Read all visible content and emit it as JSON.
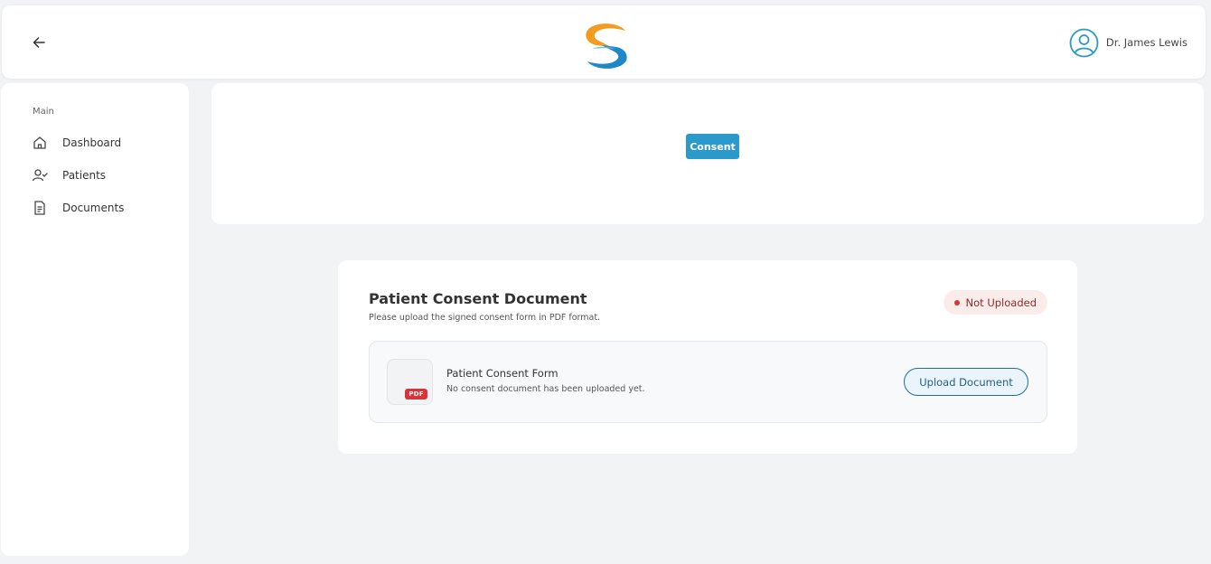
{
  "colors": {
    "accent": "#2b9acb",
    "status_not_uploaded": "#d8343c",
    "badge_bg": "#fbecec",
    "logo_orange": "#f39c1f",
    "logo_blue": "#1e88c8"
  },
  "header": {
    "back_icon": "arrow-left-icon",
    "logo_icon": "swirl-s-logo",
    "user_icon": "user-circle-icon",
    "user_name": "Dr. James Lewis"
  },
  "sidebar": {
    "section_label": "Main",
    "items": [
      {
        "label": "Dashboard",
        "icon": "home-icon"
      },
      {
        "label": "Patients",
        "icon": "user-check-icon"
      },
      {
        "label": "Documents",
        "icon": "document-icon"
      }
    ]
  },
  "top_card": {
    "consent_button_label": "Consent"
  },
  "document_card": {
    "title": "Patient Consent Document",
    "subtitle": "Please upload the signed consent form in PDF format.",
    "status_label": "Not Uploaded",
    "file": {
      "name": "Patient Consent Form",
      "description": "No consent document has been uploaded yet.",
      "type_tag": "PDF"
    },
    "upload_button_label": "Upload Document"
  }
}
